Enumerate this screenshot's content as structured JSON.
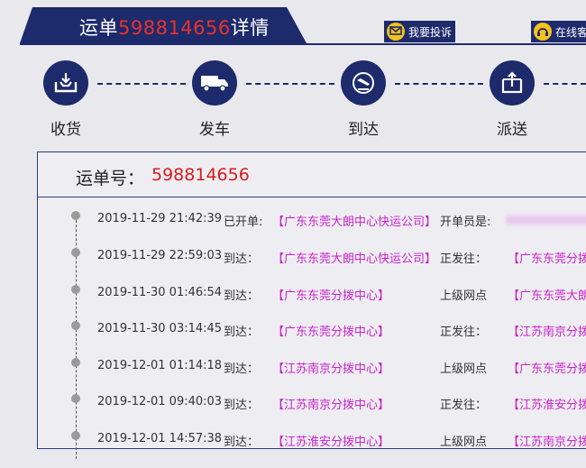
{
  "header": {
    "title_prefix": "运单",
    "title_number": "598814656",
    "title_suffix": "详情",
    "complaint_button": "我要投诉",
    "online_button": "在线客",
    "colors": {
      "navy": "#1d2a6b",
      "red": "#e8322c",
      "icon_yellow": "#f4c21b",
      "magenta": "#cc22cc"
    }
  },
  "steps": [
    {
      "label": "收货",
      "icon": "inbox-download-icon"
    },
    {
      "label": "发车",
      "icon": "truck-icon"
    },
    {
      "label": "到达",
      "icon": "plane-landing-icon"
    },
    {
      "label": "派送",
      "icon": "box-upload-icon"
    }
  ],
  "waybill": {
    "label": "运单号：",
    "number": "598814656"
  },
  "tracking": [
    {
      "time": "2019-11-29 21:42:39",
      "action": "已开单:",
      "site": "【广东东莞大朗中心快运公司】",
      "label2": "开单员是:",
      "site2": ""
    },
    {
      "time": "2019-11-29 22:59:03",
      "action": "到达：",
      "site": "【广东东莞大朗中心快运公司】",
      "label2": "正发往：",
      "site2": "【广东东莞分拨"
    },
    {
      "time": "2019-11-30 01:46:54",
      "action": "到达：",
      "site": "【广东东莞分拨中心】",
      "label2": "上级网点",
      "site2": "【广东东莞大朗"
    },
    {
      "time": "2019-11-30 03:14:45",
      "action": "到达：",
      "site": "【广东东莞分拨中心】",
      "label2": "正发往：",
      "site2": "【江苏南京分拨"
    },
    {
      "time": "2019-12-01 01:14:18",
      "action": "到达：",
      "site": "【江苏南京分拨中心】",
      "label2": "上级网点",
      "site2": "【广东东莞分拨"
    },
    {
      "time": "2019-12-01 09:40:03",
      "action": "到达：",
      "site": "【江苏南京分拨中心】",
      "label2": "正发往：",
      "site2": "【江苏淮安分拨"
    },
    {
      "time": "2019-12-01 14:57:38",
      "action": "到达：",
      "site": "【江苏淮安分拨中心】",
      "label2": "上级网点",
      "site2": "【江苏南京分拨"
    }
  ]
}
